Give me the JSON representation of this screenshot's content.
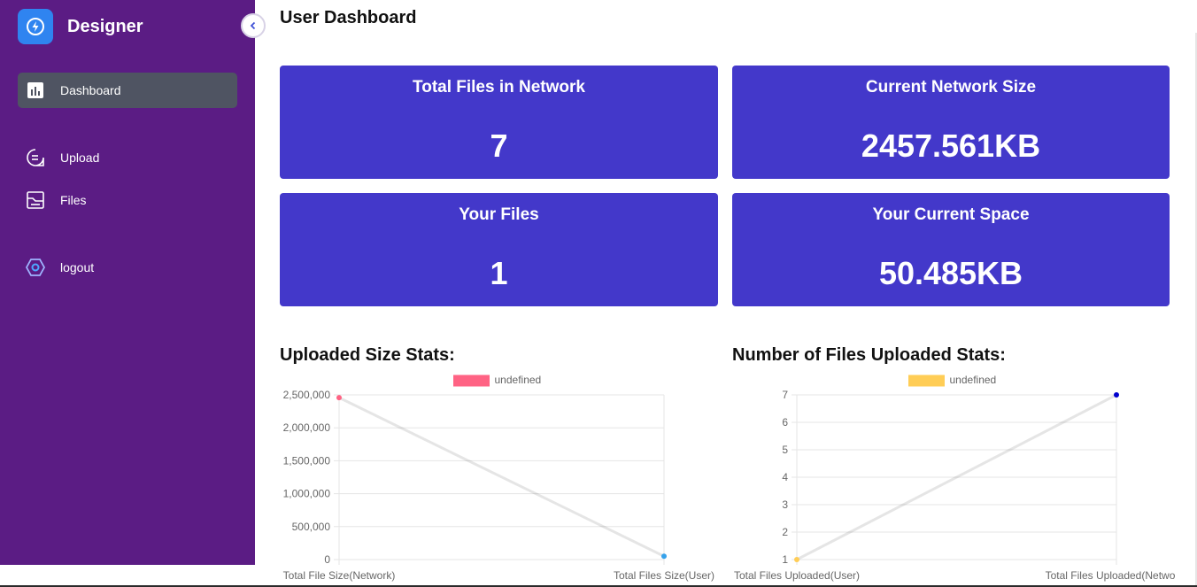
{
  "app": {
    "name": "Designer"
  },
  "sidebar": {
    "items": [
      {
        "label": "Dashboard",
        "icon": "bar-chart-icon",
        "active": true
      },
      {
        "label": "Upload",
        "icon": "upload-icon",
        "active": false
      },
      {
        "label": "Files",
        "icon": "files-icon",
        "active": false
      },
      {
        "label": "logout",
        "icon": "logout-icon",
        "active": false
      }
    ]
  },
  "page": {
    "title": "User Dashboard"
  },
  "cards": [
    {
      "title": "Total Files in Network",
      "value": "7"
    },
    {
      "title": "Current Network Size",
      "value": "2457.561KB"
    },
    {
      "title": "Your Files",
      "value": "1"
    },
    {
      "title": "Your Current Space",
      "value": "50.485KB"
    }
  ],
  "colors": {
    "sidebar": "#5b1c84",
    "card": "#4338ca",
    "active_nav": "#4f5462",
    "logo": "#2f84f0"
  },
  "chart_data": [
    {
      "type": "line",
      "title": "Uploaded Size Stats:",
      "categories": [
        "Total File Size(Network)",
        "Total Files Size(User)"
      ],
      "series": [
        {
          "name": "undefined",
          "values": [
            2457561,
            50485
          ],
          "legend_color": "#ff6384",
          "point_colors": [
            "#ff6384",
            "#36a2eb"
          ]
        }
      ],
      "yticks": [
        "0",
        "500,000",
        "1,000,000",
        "1,500,000",
        "2,000,000",
        "2,500,000"
      ],
      "ylim": [
        0,
        2500000
      ],
      "legend": "top-center",
      "grid": true
    },
    {
      "type": "line",
      "title": "Number of Files Uploaded Stats:",
      "categories": [
        "Total Files Uploaded(User)",
        "Total Files Uploaded(Network)"
      ],
      "series": [
        {
          "name": "undefined",
          "values": [
            1,
            7
          ],
          "legend_color": "#ffcd56",
          "point_colors": [
            "#ffcd56",
            "#0000cd"
          ]
        }
      ],
      "yticks": [
        "1",
        "2",
        "3",
        "4",
        "5",
        "6",
        "7"
      ],
      "ylim": [
        1,
        7
      ],
      "legend": "top-center",
      "grid": true
    }
  ]
}
